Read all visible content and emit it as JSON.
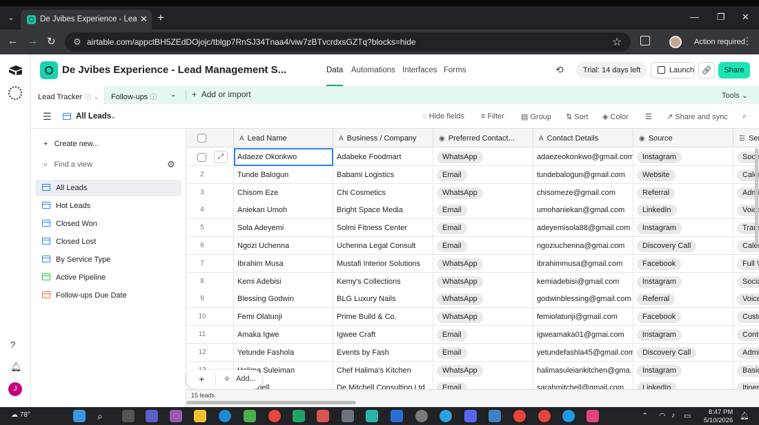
{
  "browser": {
    "tab_title": "De Jvibes Experience - Lead Ma",
    "url": "airtable.com/appctBH5ZEdDOjojc/tblgp7RnSJ34Tnaa4/viw7zBTvcrdxsGZTq?blocks=hide",
    "action_required": "Action required"
  },
  "app": {
    "base_name": "De Jvibes Experience - Lead Management S...",
    "nav": [
      "Data",
      "Automations",
      "Interfaces",
      "Forms"
    ],
    "active_nav": "Data",
    "trial": "Trial: 14 days left",
    "launch_label": "Launch",
    "share_label": "Share",
    "accent_color": "#19e6b3",
    "avatar_initial": "J"
  },
  "tables": {
    "active": "Lead Tracker",
    "other": "Follow-ups",
    "add_label": "Add or import",
    "tools_label": "Tools"
  },
  "view": {
    "name": "All Leads",
    "toolbar": [
      "Hide fields",
      "Filter",
      "Group",
      "Sort",
      "Color",
      "Share and sync"
    ]
  },
  "sidebar": {
    "create_label": "Create new...",
    "find_placeholder": "Find a view",
    "views": [
      {
        "label": "All Leads",
        "icon": "grid-view-icon",
        "color": "#2d7ff9"
      },
      {
        "label": "Hot Leads",
        "icon": "grid-view-icon",
        "color": "#2d7ff9"
      },
      {
        "label": "Closed Won",
        "icon": "grid-view-icon",
        "color": "#2d7ff9"
      },
      {
        "label": "Closed Lost",
        "icon": "grid-view-icon",
        "color": "#2d7ff9"
      },
      {
        "label": "By Service Type",
        "icon": "grid-view-icon",
        "color": "#2d7ff9"
      },
      {
        "label": "Active Pipeline",
        "icon": "kanban-view-icon",
        "color": "#20c933"
      },
      {
        "label": "Follow-ups Due Date",
        "icon": "calendar-view-icon",
        "color": "#ff6f2c"
      }
    ]
  },
  "grid": {
    "columns": [
      "Lead Name",
      "Business / Company",
      "Preferred Contact...",
      "Contact Details",
      "Source",
      "Ser"
    ],
    "rows": [
      {
        "num": "1",
        "name": "Adaeze Okonkwo",
        "business": "Adabeke Foodmart",
        "contact": "WhatsApp",
        "details": "adaezeokonkwo@gmail.com",
        "source": "Instagram",
        "service": "Social"
      },
      {
        "num": "2",
        "name": "Tunde Balogun",
        "business": "Babami Logistics",
        "contact": "Email",
        "details": "tundebalogun@gmail.com",
        "source": "Website",
        "service": "Calen"
      },
      {
        "num": "3",
        "name": "Chisom Eze",
        "business": "Chi Cosmetics",
        "contact": "WhatsApp",
        "details": "chisomeze@gmail.com",
        "source": "Referral",
        "service": "Admi"
      },
      {
        "num": "4",
        "name": "Aniekan Umoh",
        "business": "Bright Space Media",
        "contact": "Email",
        "details": "umohaniekan@gmail.com",
        "source": "LinkedIn",
        "service": "Voice"
      },
      {
        "num": "5",
        "name": "Sola Adeyemi",
        "business": "Solmi Fitness Center",
        "contact": "Email",
        "details": "adeyemisola88@gmail.com",
        "source": "Instagram",
        "service": "Transi"
      },
      {
        "num": "6",
        "name": "Ngozi Uchenna",
        "business": "Uchenna Legal Consult",
        "contact": "Email",
        "details": "ngoziuchenna@gmai.com",
        "source": "Discovery Call",
        "service": "Calen"
      },
      {
        "num": "7",
        "name": "Ibrahim Musa",
        "business": "Mustafi Interior Solutions",
        "contact": "WhatsApp",
        "details": "ibrahimmusa@gmail.com",
        "source": "Facebook",
        "service": "Full V"
      },
      {
        "num": "8",
        "name": "Kemi Adebisi",
        "business": "Kemy's Collections",
        "contact": "WhatsApp",
        "details": "kemiadebisi@gmail.com",
        "source": "Instagram",
        "service": "Social"
      },
      {
        "num": "9",
        "name": "Blessing Godwin",
        "business": "BLG Luxury Nails",
        "contact": "WhatsApp",
        "details": "godwinblessing@gmail.com",
        "source": "Referral",
        "service": "Voice"
      },
      {
        "num": "10",
        "name": "Femi Olatunji",
        "business": "Prime Build & Co.",
        "contact": "WhatsApp",
        "details": "femiolatunji@gmail.com",
        "source": "Facebook",
        "service": "Custo"
      },
      {
        "num": "11",
        "name": "Amaka Igwe",
        "business": "Igwee Craft",
        "contact": "Email",
        "details": "igweamaka01@gmai.com",
        "source": "Instagram",
        "service": "Conte"
      },
      {
        "num": "12",
        "name": "Yetunde Fashola",
        "business": "Events by Fash",
        "contact": "Email",
        "details": "yetundefashla45@gmail.com",
        "source": "Discovery Call",
        "service": "Admi"
      },
      {
        "num": "13",
        "name": "Halima Suleiman",
        "business": "Chef Halima's Kitchen",
        "contact": "WhatsApp",
        "details": "halimasuleiankitchen@gma...",
        "source": "Instagram",
        "service": "Basic"
      },
      {
        "num": "14",
        "name": "...Mitchell",
        "business": "De Mitchell Consulting Ltd",
        "contact": "Email",
        "details": "sarahmitchell@gmail.com",
        "source": "LinkedIn",
        "service": "Itiner"
      }
    ],
    "add_label": "Add...",
    "count": "15 leads"
  },
  "taskbar": {
    "temperature": "78°",
    "time": "8:47 PM",
    "date": "5/10/2026"
  }
}
